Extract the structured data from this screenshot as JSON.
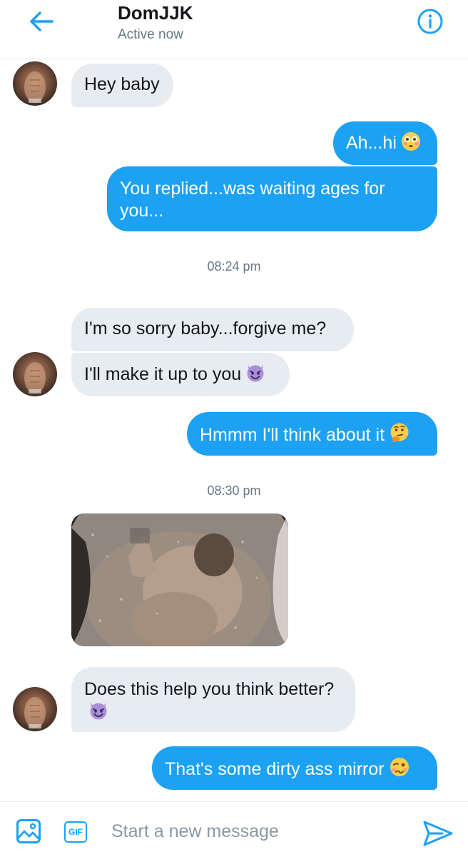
{
  "header": {
    "title": "DomJJK",
    "status": "Active now"
  },
  "messages": [
    {
      "text": "Hey baby"
    },
    {
      "text": "Ah...hi"
    },
    {
      "text": "You replied...was waiting ages for you..."
    },
    {
      "text": "I'm so sorry baby...forgive me?"
    },
    {
      "text": "I'll make it up to you"
    },
    {
      "text": "Hmmm I'll think about it"
    },
    {
      "text": "Does this help you think better?"
    },
    {
      "text": "That's some dirty ass mirror"
    }
  ],
  "timestamps": [
    "08:24 pm",
    "08:30 pm"
  ],
  "composer": {
    "gif_label": "GIF",
    "placeholder": "Start a new message"
  },
  "icons": {
    "back": "arrow-left-icon",
    "info": "info-circle-icon",
    "image": "image-icon",
    "gif": "gif-icon",
    "send": "send-icon",
    "emoji_flushed": "flushed-face-emoji",
    "emoji_devil": "smiling-devil-emoji",
    "emoji_thinking": "thinking-face-emoji",
    "emoji_woozy": "woozy-face-emoji"
  },
  "colors": {
    "accent": "#1da1f2",
    "incoming_bubble": "#e6ecf0",
    "muted_text": "#657786"
  }
}
